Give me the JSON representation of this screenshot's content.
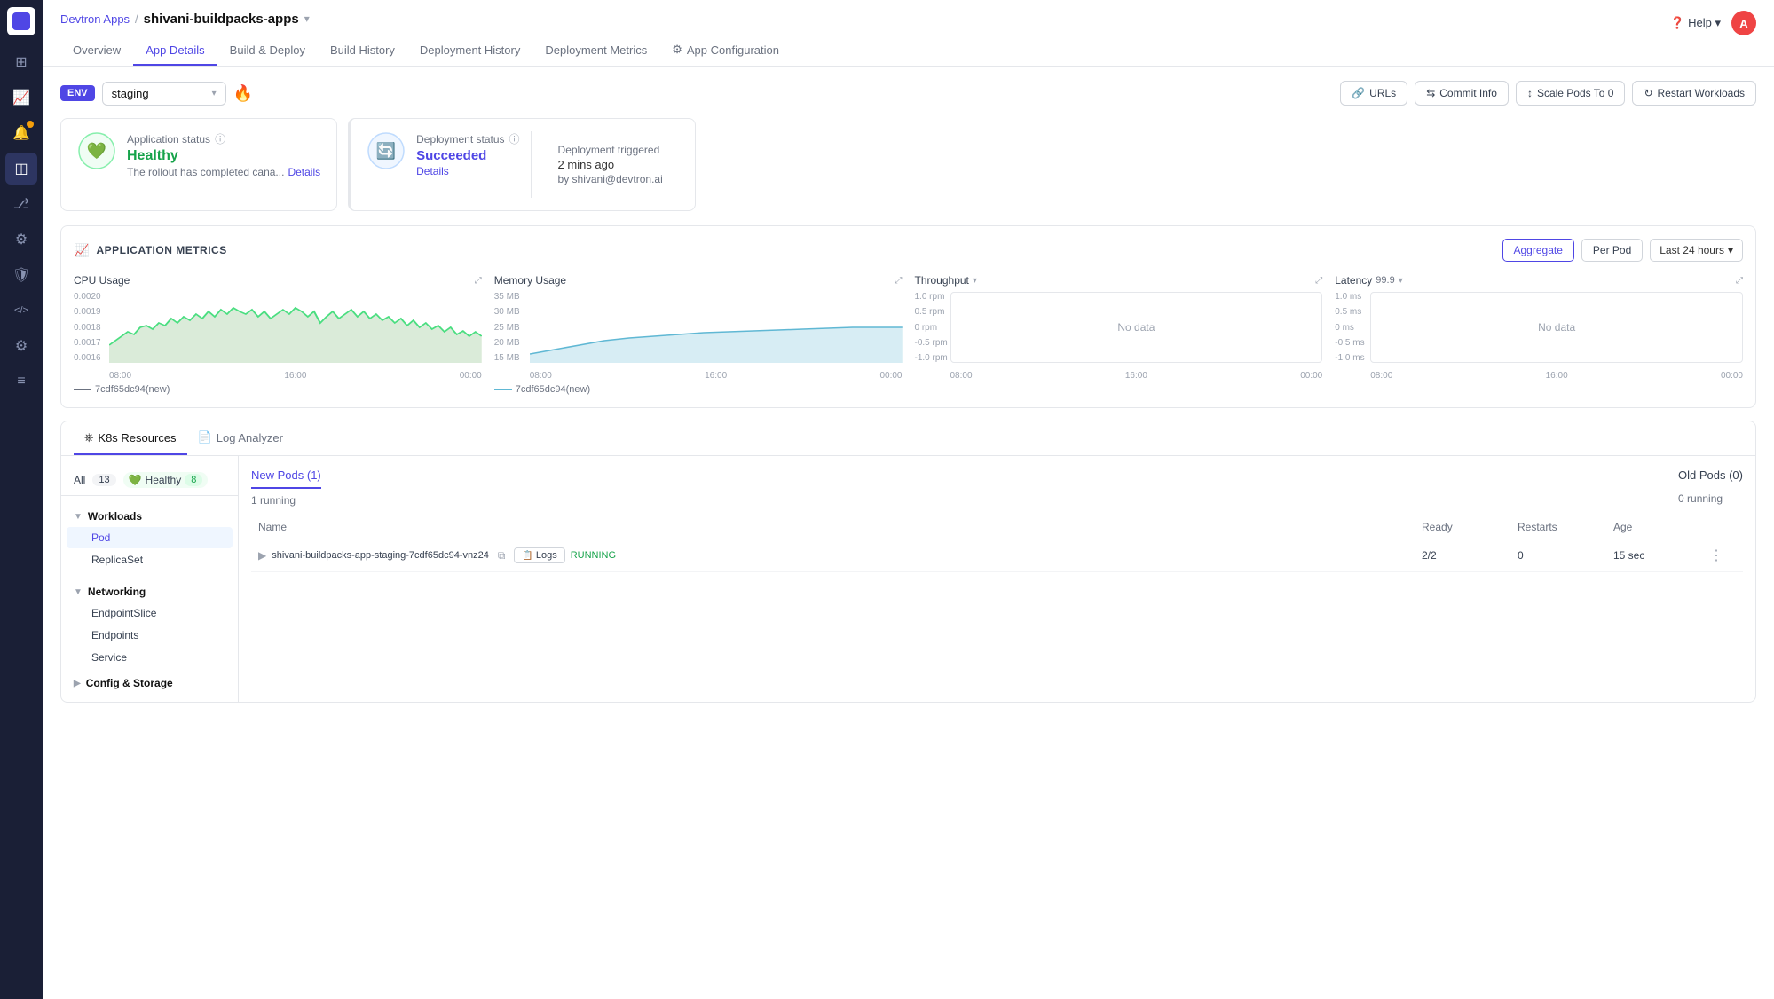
{
  "sidebar": {
    "logo": "D",
    "icons": [
      {
        "name": "grid-icon",
        "symbol": "⊞",
        "active": false
      },
      {
        "name": "chart-icon",
        "symbol": "📊",
        "active": false
      },
      {
        "name": "alert-icon",
        "symbol": "🔔",
        "active": true,
        "badge": true
      },
      {
        "name": "layers-icon",
        "symbol": "◫",
        "active": true
      },
      {
        "name": "git-icon",
        "symbol": "⎇",
        "active": false
      },
      {
        "name": "settings-icon",
        "symbol": "⚙",
        "active": false
      },
      {
        "name": "shield-icon",
        "symbol": "🛡",
        "active": false
      },
      {
        "name": "code-icon",
        "symbol": "</>",
        "active": false
      },
      {
        "name": "config-icon",
        "symbol": "⚙",
        "active": false
      },
      {
        "name": "stack-icon",
        "symbol": "≡",
        "active": false
      }
    ]
  },
  "breadcrumb": {
    "parent": "Devtron Apps",
    "separator": "/",
    "current": "shivani-buildpacks-apps",
    "chevron": "▾"
  },
  "header": {
    "help_label": "Help",
    "user_initial": "A"
  },
  "nav_tabs": [
    {
      "id": "overview",
      "label": "Overview",
      "active": false
    },
    {
      "id": "app-details",
      "label": "App Details",
      "active": true
    },
    {
      "id": "build-deploy",
      "label": "Build & Deploy",
      "active": false
    },
    {
      "id": "build-history",
      "label": "Build History",
      "active": false
    },
    {
      "id": "deployment-history",
      "label": "Deployment History",
      "active": false
    },
    {
      "id": "deployment-metrics",
      "label": "Deployment Metrics",
      "active": false
    },
    {
      "id": "app-configuration",
      "label": "App Configuration",
      "active": false
    }
  ],
  "toolbar": {
    "env_label": "ENV",
    "env_value": "staging",
    "env_chevron": "▾",
    "flame_icon": "🔥",
    "urls_label": "URLs",
    "commit_info_label": "Commit Info",
    "scale_pods_label": "Scale Pods To 0",
    "restart_label": "Restart Workloads"
  },
  "status": {
    "app_status_title": "Application status",
    "app_status_value": "Healthy",
    "app_status_desc": "The rollout has completed cana...",
    "app_status_link": "Details",
    "deployment_status_title": "Deployment status",
    "deployment_status_value": "Succeeded",
    "deployment_status_link": "Details",
    "deployment_triggered_label": "Deployment triggered",
    "deployment_time": "2 mins ago",
    "deployment_user": "by shivani@devtron.ai"
  },
  "metrics": {
    "section_title": "APPLICATION METRICS",
    "aggregate_label": "Aggregate",
    "per_pod_label": "Per Pod",
    "time_range_label": "Last 24 hours",
    "cpu": {
      "title": "CPU Usage",
      "y_labels": [
        "0.0020",
        "0.0019",
        "0.0018",
        "0.0017",
        "0.0016"
      ],
      "x_labels": [
        "08:00",
        "16:00",
        "00:00"
      ],
      "legend": "7cdf65dc94(new)"
    },
    "memory": {
      "title": "Memory Usage",
      "y_labels": [
        "35 MB",
        "30 MB",
        "25 MB",
        "20 MB",
        "15 MB"
      ],
      "x_labels": [
        "08:00",
        "16:00",
        "00:00"
      ],
      "legend": "7cdf65dc94(new)"
    },
    "throughput": {
      "title": "Throughput",
      "y_labels": [
        "1.0 rpm",
        "0.5 rpm",
        "0 rpm",
        "-0.5 rpm",
        "-1.0 rpm"
      ],
      "x_labels": [
        "08:00",
        "16:00",
        "00:00"
      ],
      "no_data": "No data"
    },
    "latency": {
      "title": "Latency",
      "subtitle": "99.9",
      "y_labels": [
        "1.0 ms",
        "0.5 ms",
        "0 ms",
        "-0.5 ms",
        "-1.0 ms"
      ],
      "x_labels": [
        "08:00",
        "16:00",
        "00:00"
      ],
      "no_data": "No data"
    }
  },
  "resources": {
    "tab_k8s": "K8s Resources",
    "tab_log": "Log Analyzer",
    "filter_all": "All",
    "filter_all_count": "13",
    "filter_healthy": "Healthy",
    "filter_healthy_count": "8",
    "workloads_label": "Workloads",
    "pod_item": "Pod",
    "replicaset_item": "ReplicaSet",
    "networking_label": "Networking",
    "endpoint_slice_item": "EndpointSlice",
    "endpoints_item": "Endpoints",
    "service_item": "Service",
    "config_label": "Config & Storage"
  },
  "pods": {
    "new_pods_label": "New Pods (1)",
    "new_pods_running": "1 running",
    "old_pods_label": "Old Pods (0)",
    "old_pods_running": "0 running",
    "col_name": "Name",
    "col_ready": "Ready",
    "col_restarts": "Restarts",
    "col_age": "Age",
    "rows": [
      {
        "name": "shivani-buildpacks-app-staging-7cdf65dc94-vnz24",
        "status": "RUNNING",
        "ready": "2/2",
        "restarts": "0",
        "age": "15 sec",
        "logs_label": "Logs"
      }
    ]
  }
}
